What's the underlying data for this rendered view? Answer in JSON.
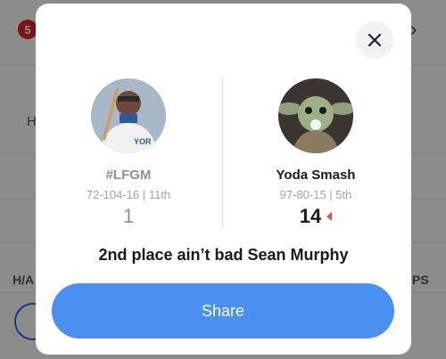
{
  "background": {
    "badge_count": "5",
    "left_tab_label": "H",
    "home_away_label": "H/A",
    "stat_label": "PS"
  },
  "modal": {
    "close_icon": "close-icon",
    "left_team": {
      "name": "#LFGM",
      "record": "72-104-16 | 11th",
      "score": "1"
    },
    "right_team": {
      "name": "Yoda Smash",
      "record": "97-80-15 | 5th",
      "score": "14",
      "winner_indicator_color": "#e6542b"
    },
    "message": "2nd place ain’t bad Sean Murphy",
    "share_label": "Share",
    "share_color": "#4a90f0"
  }
}
